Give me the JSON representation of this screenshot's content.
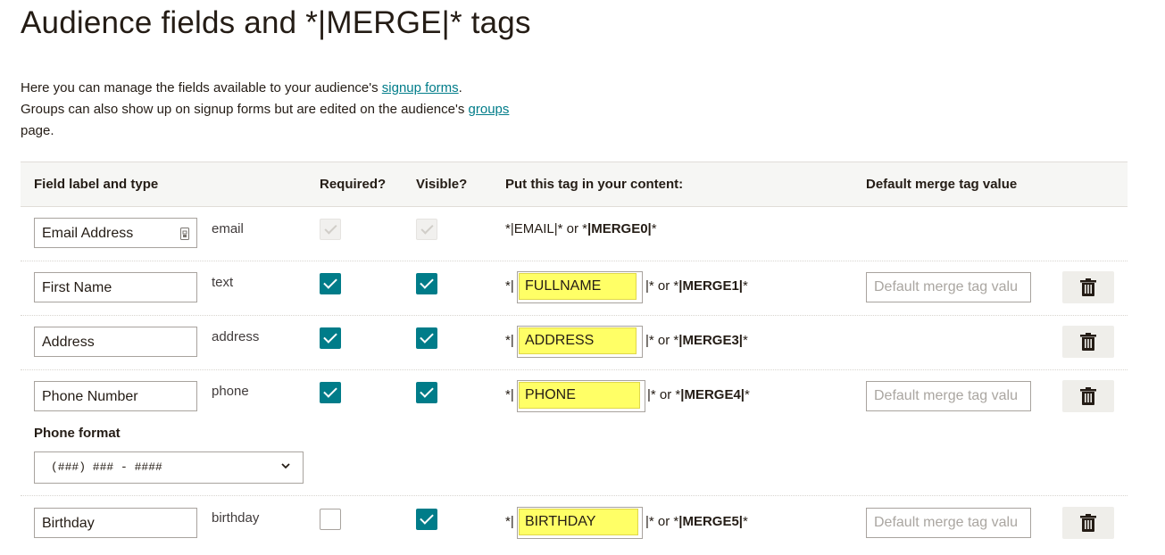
{
  "page": {
    "title": "Audience fields and *|MERGE|* tags",
    "intro_line1_pre": "Here you can manage the fields available to your audience's ",
    "intro_link1": "signup forms",
    "intro_line1_post": ".",
    "intro_line2_pre": "Groups can also show up on signup forms but are edited on the audience's ",
    "intro_link2": "groups",
    "intro_line2_post": "page."
  },
  "table": {
    "headers": {
      "field": "Field label and type",
      "required": "Required?",
      "visible": "Visible?",
      "tag": "Put this tag in your content:",
      "default": "Default merge tag value"
    },
    "rows": [
      {
        "label": "Email Address",
        "type": "email",
        "required": "disabled-checked",
        "visible": "disabled-checked",
        "tag_text_pre": "*|EMAIL|* or *",
        "tag_text_bold": "|MERGE0|",
        "tag_text_post": "*"
      },
      {
        "label": "First Name",
        "type": "text",
        "required": true,
        "visible": true,
        "tag_prefix": "*|",
        "tag": "FULLNAME",
        "tag_suffix_pre": "|* or *",
        "tag_suffix_bold": "|MERGE1|",
        "tag_suffix_post": "*",
        "default_placeholder": "Default merge tag valu"
      },
      {
        "label": "Address",
        "type": "address",
        "required": true,
        "visible": true,
        "tag_prefix": "*|",
        "tag": "ADDRESS",
        "tag_suffix_pre": "|* or *",
        "tag_suffix_bold": "|MERGE3|",
        "tag_suffix_post": "*"
      },
      {
        "label": "Phone Number",
        "type": "phone",
        "required": true,
        "visible": true,
        "tag_prefix": "*|",
        "tag": "PHONE",
        "tag_suffix_pre": "|* or *",
        "tag_suffix_bold": "|MERGE4|",
        "tag_suffix_post": "*",
        "default_placeholder": "Default merge tag valu",
        "phone_format_label": "Phone format",
        "phone_format_value": "(###) ### - ####"
      },
      {
        "label": "Birthday",
        "type": "birthday",
        "required": false,
        "visible": true,
        "tag_prefix": "*|",
        "tag": "BIRTHDAY",
        "tag_suffix_pre": "|* or *",
        "tag_suffix_bold": "|MERGE5|",
        "tag_suffix_post": "*",
        "default_placeholder": "Default merge tag valu"
      }
    ]
  },
  "icons": {
    "lock": "lock-icon",
    "trash": "trash-icon",
    "chevron": "chevron-down-icon"
  },
  "colors": {
    "accent": "#007c89",
    "highlight": "#ffff66",
    "text": "#241c15",
    "header_bg": "#f6f6f4"
  }
}
